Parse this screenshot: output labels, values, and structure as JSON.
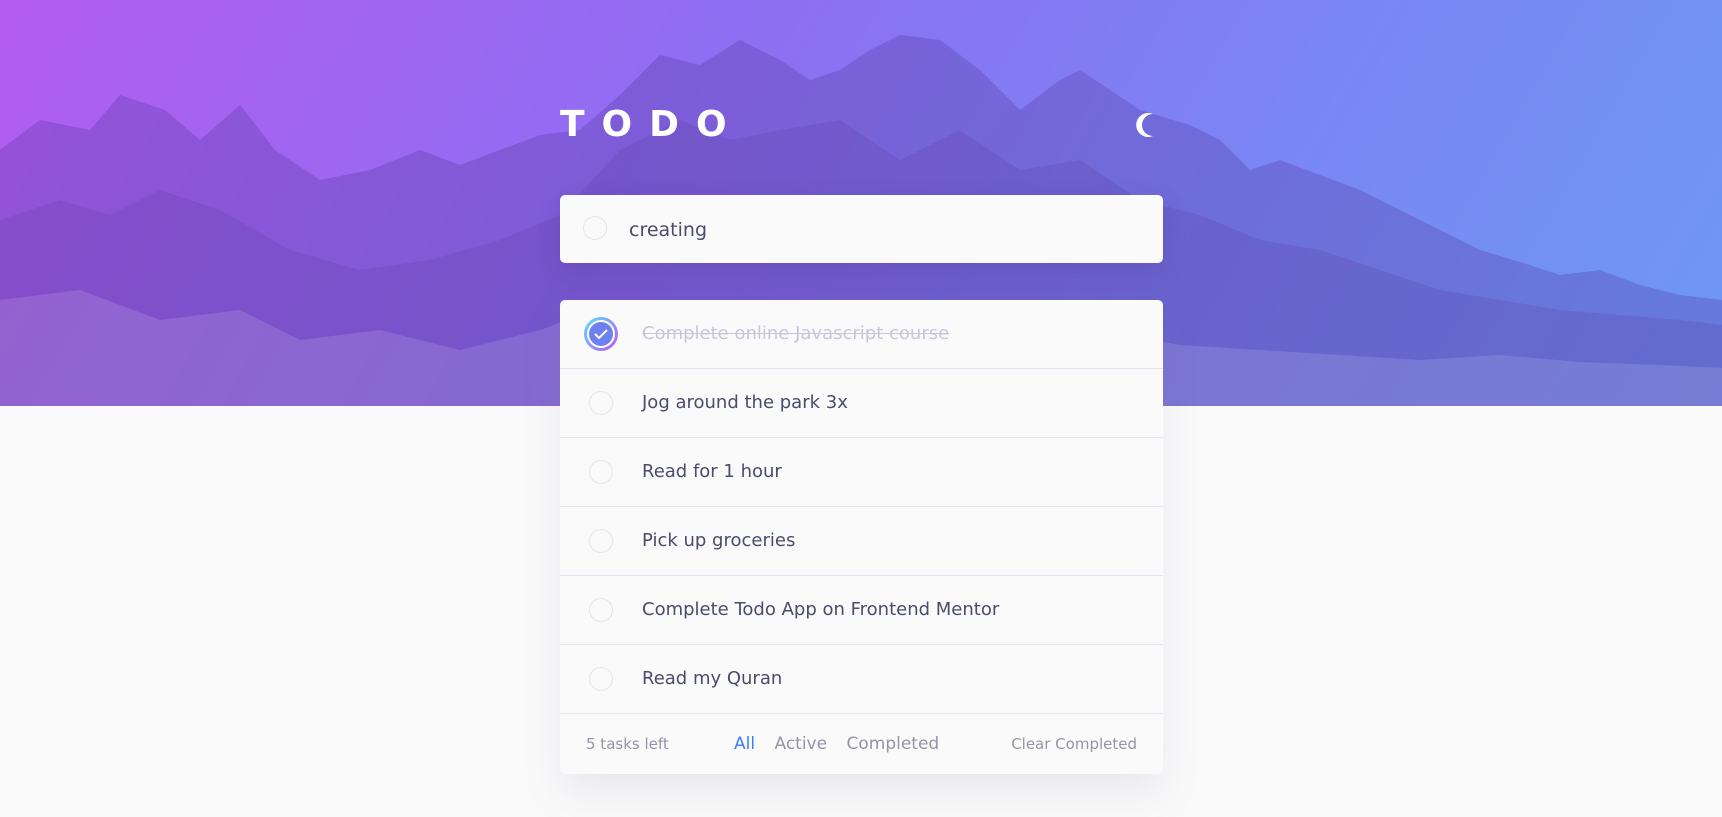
{
  "app": {
    "title": "TODO"
  },
  "theme_toggle": {
    "icon": "moon-icon"
  },
  "new_todo": {
    "value": "creating"
  },
  "todos": [
    {
      "text": "Complete online Javascript course",
      "completed": true
    },
    {
      "text": "Jog around the park 3x",
      "completed": false
    },
    {
      "text": "Read for 1 hour",
      "completed": false
    },
    {
      "text": "Pick up groceries",
      "completed": false
    },
    {
      "text": "Complete Todo App on Frontend Mentor",
      "completed": false
    },
    {
      "text": "Read my Quran",
      "completed": false
    }
  ],
  "footer": {
    "items_left": "5 tasks left",
    "filters": {
      "all": "All",
      "active": "Active",
      "completed": "Completed",
      "selected": "All"
    },
    "clear": "Clear Completed"
  },
  "colors": {
    "gradient_start": "#b35cf0",
    "gradient_end": "#6e98f5",
    "accent": "#3a7cfd",
    "text": "#494c6b",
    "muted": "#9495a5",
    "background": "#fafafa"
  }
}
